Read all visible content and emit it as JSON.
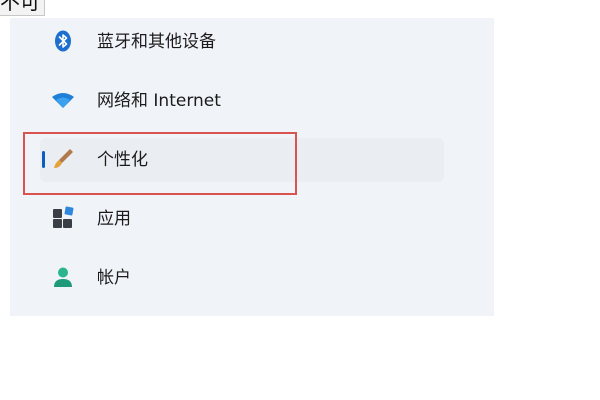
{
  "fragment_text": "不可",
  "nav": {
    "items": [
      {
        "label": "蓝牙和其他设备",
        "icon": "bluetooth-icon",
        "selected": false
      },
      {
        "label": "网络和 Internet",
        "icon": "wifi-icon",
        "selected": false
      },
      {
        "label": "个性化",
        "icon": "brush-icon",
        "selected": true
      },
      {
        "label": "应用",
        "icon": "apps-icon",
        "selected": false
      },
      {
        "label": "帐户",
        "icon": "account-icon",
        "selected": false
      }
    ]
  },
  "colors": {
    "panel_bg": "#f0f4f9",
    "selected_bg": "#eaeef3",
    "accent": "#0a5ec2",
    "annotation_box": "#d9534f"
  }
}
